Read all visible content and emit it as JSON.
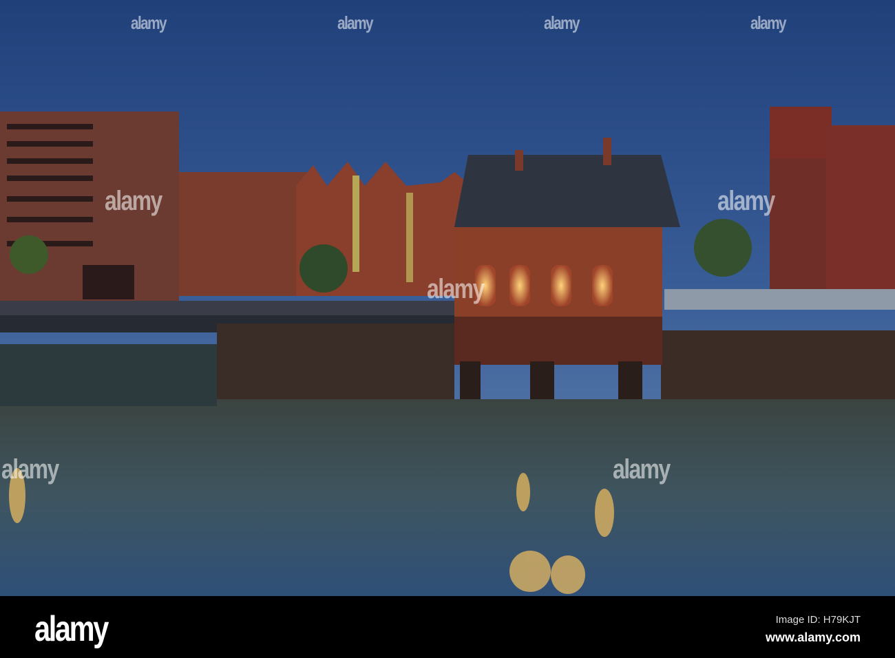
{
  "photo": {
    "subject": "Fleetinsel house by canal at dusk",
    "colors": {
      "sky": "#2d4f8a",
      "water": "#3c4a4c",
      "brick": "#7a3a2a",
      "lamp": "#f4b450"
    }
  },
  "watermark": {
    "text": "alamy"
  },
  "footer": {
    "logo": "alamy",
    "image_id": "Image ID: H79KJT",
    "url": "www.alamy.com"
  }
}
